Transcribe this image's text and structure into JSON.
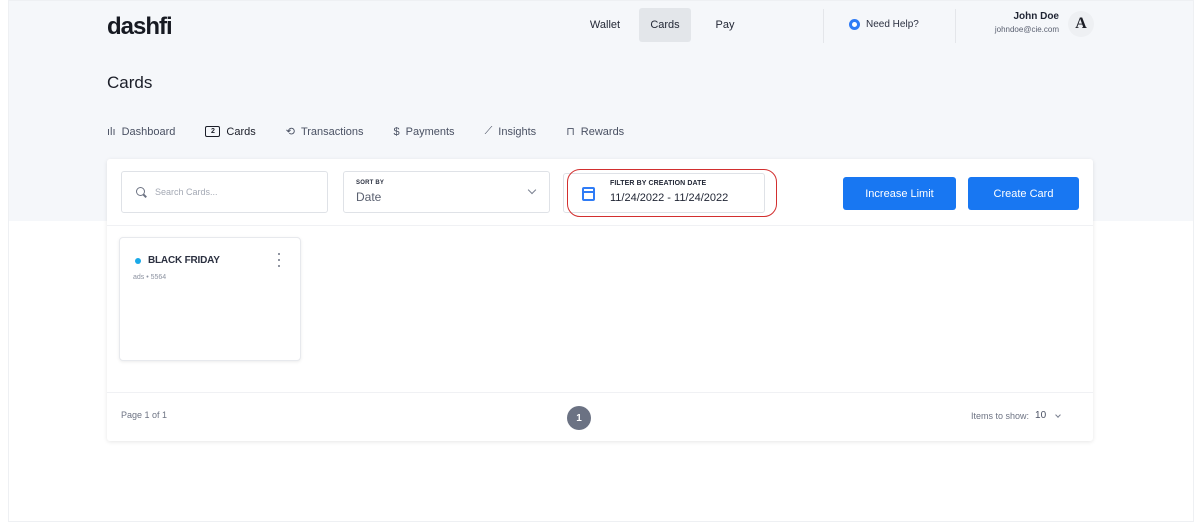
{
  "app": {
    "logo": "dashfi"
  },
  "top_nav": [
    {
      "label": "Wallet",
      "active": false
    },
    {
      "label": "Cards",
      "active": true
    },
    {
      "label": "Pay",
      "active": false
    }
  ],
  "help": {
    "label": "Need Help?"
  },
  "user": {
    "name": "John Doe",
    "email": "johndoe@cie.com",
    "avatar_letter": "A"
  },
  "page": {
    "title": "Cards"
  },
  "sub_nav": [
    {
      "label": "Dashboard",
      "icon": "bar-chart-icon",
      "glyph": "ılı",
      "active": false
    },
    {
      "label": "Cards",
      "icon": "cards-icon",
      "glyph": "2",
      "active": true
    },
    {
      "label": "Transactions",
      "icon": "transfer-icon",
      "glyph": "⟲",
      "active": false
    },
    {
      "label": "Payments",
      "icon": "dollar-icon",
      "glyph": "$",
      "active": false
    },
    {
      "label": "Insights",
      "icon": "trend-icon",
      "glyph": "⟋",
      "active": false
    },
    {
      "label": "Rewards",
      "icon": "gift-icon",
      "glyph": "⊓",
      "active": false
    }
  ],
  "filters": {
    "search_placeholder": "Search Cards...",
    "sort_label": "SORT BY",
    "sort_value": "Date",
    "date_label": "FILTER BY CREATION DATE",
    "date_value": "11/24/2022 - 11/24/2022"
  },
  "actions": {
    "increase_limit": "Increase Limit",
    "create_card": "Create Card"
  },
  "cards": [
    {
      "name": "BLACK FRIDAY",
      "sub": "ads • 5564",
      "status_color": "#1aa9e8"
    }
  ],
  "pagination": {
    "page_info": "Page 1 of 1",
    "current_page": "1",
    "items_label": "Items to show:",
    "items_value": "10"
  },
  "colors": {
    "accent": "#1877f2",
    "highlight": "#d22f2f",
    "background": "#f5f7fa"
  }
}
